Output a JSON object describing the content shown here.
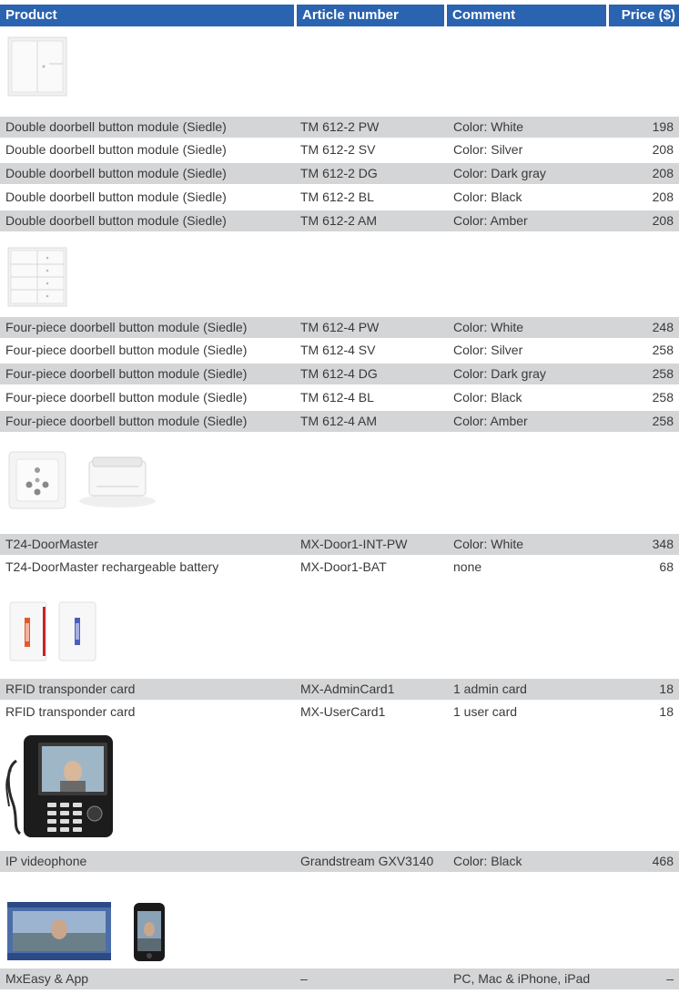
{
  "header": {
    "product": "Product",
    "article": "Article number",
    "comment": "Comment",
    "price": "Price ($)"
  },
  "rows": [
    {
      "product": "Double doorbell button module (Siedle)",
      "article": "TM 612-2 PW",
      "comment": "Color: White",
      "price": "198"
    },
    {
      "product": "Double doorbell button module (Siedle)",
      "article": "TM 612-2 SV",
      "comment": "Color: Silver",
      "price": "208"
    },
    {
      "product": "Double doorbell button module (Siedle)",
      "article": "TM 612-2 DG",
      "comment": "Color: Dark gray",
      "price": "208"
    },
    {
      "product": "Double doorbell button module (Siedle)",
      "article": "TM 612-2 BL",
      "comment": "Color: Black",
      "price": "208"
    },
    {
      "product": "Double doorbell button module (Siedle)",
      "article": "TM 612-2 AM",
      "comment": "Color: Amber",
      "price": "208"
    },
    {
      "product": "Four-piece doorbell button module (Siedle)",
      "article": "TM 612-4 PW",
      "comment": "Color: White",
      "price": "248"
    },
    {
      "product": "Four-piece doorbell button module (Siedle)",
      "article": "TM 612-4 SV",
      "comment": "Color: Silver",
      "price": "258"
    },
    {
      "product": "Four-piece doorbell button module (Siedle)",
      "article": "TM 612-4 DG",
      "comment": "Color: Dark gray",
      "price": "258"
    },
    {
      "product": "Four-piece doorbell button module (Siedle)",
      "article": "TM 612-4 BL",
      "comment": "Color: Black",
      "price": "258"
    },
    {
      "product": "Four-piece doorbell button module (Siedle)",
      "article": "TM 612-4 AM",
      "comment": "Color: Amber",
      "price": "258"
    },
    {
      "product": "T24-DoorMaster",
      "article": "MX-Door1-INT-PW",
      "comment": "Color: White",
      "price": "348"
    },
    {
      "product": "T24-DoorMaster rechargeable battery",
      "article": "MX-Door1-BAT",
      "comment": "none",
      "price": "68"
    },
    {
      "product": "RFID transponder card",
      "article": "MX-AdminCard1",
      "comment": "1 admin card",
      "price": "18"
    },
    {
      "product": "RFID transponder card",
      "article": "MX-UserCard1",
      "comment": "1 user card",
      "price": "18"
    },
    {
      "product": "IP videophone",
      "article": "Grandstream GXV3140",
      "comment": "Color: Black",
      "price": "468"
    },
    {
      "product": "MxEasy & App",
      "article": "–",
      "comment": "PC, Mac & iPhone, iPad",
      "price": "–"
    }
  ],
  "colors": {
    "header_bg": "#2a63b0",
    "row_shade": "#d4d5d7"
  },
  "icons": [
    "double-button-module-image",
    "four-button-module-image",
    "doormaster-image",
    "doormaster-battery-image",
    "rfid-card-admin-image",
    "rfid-card-user-image",
    "videophone-image",
    "mxeasy-screenshot-image",
    "iphone-app-image"
  ]
}
